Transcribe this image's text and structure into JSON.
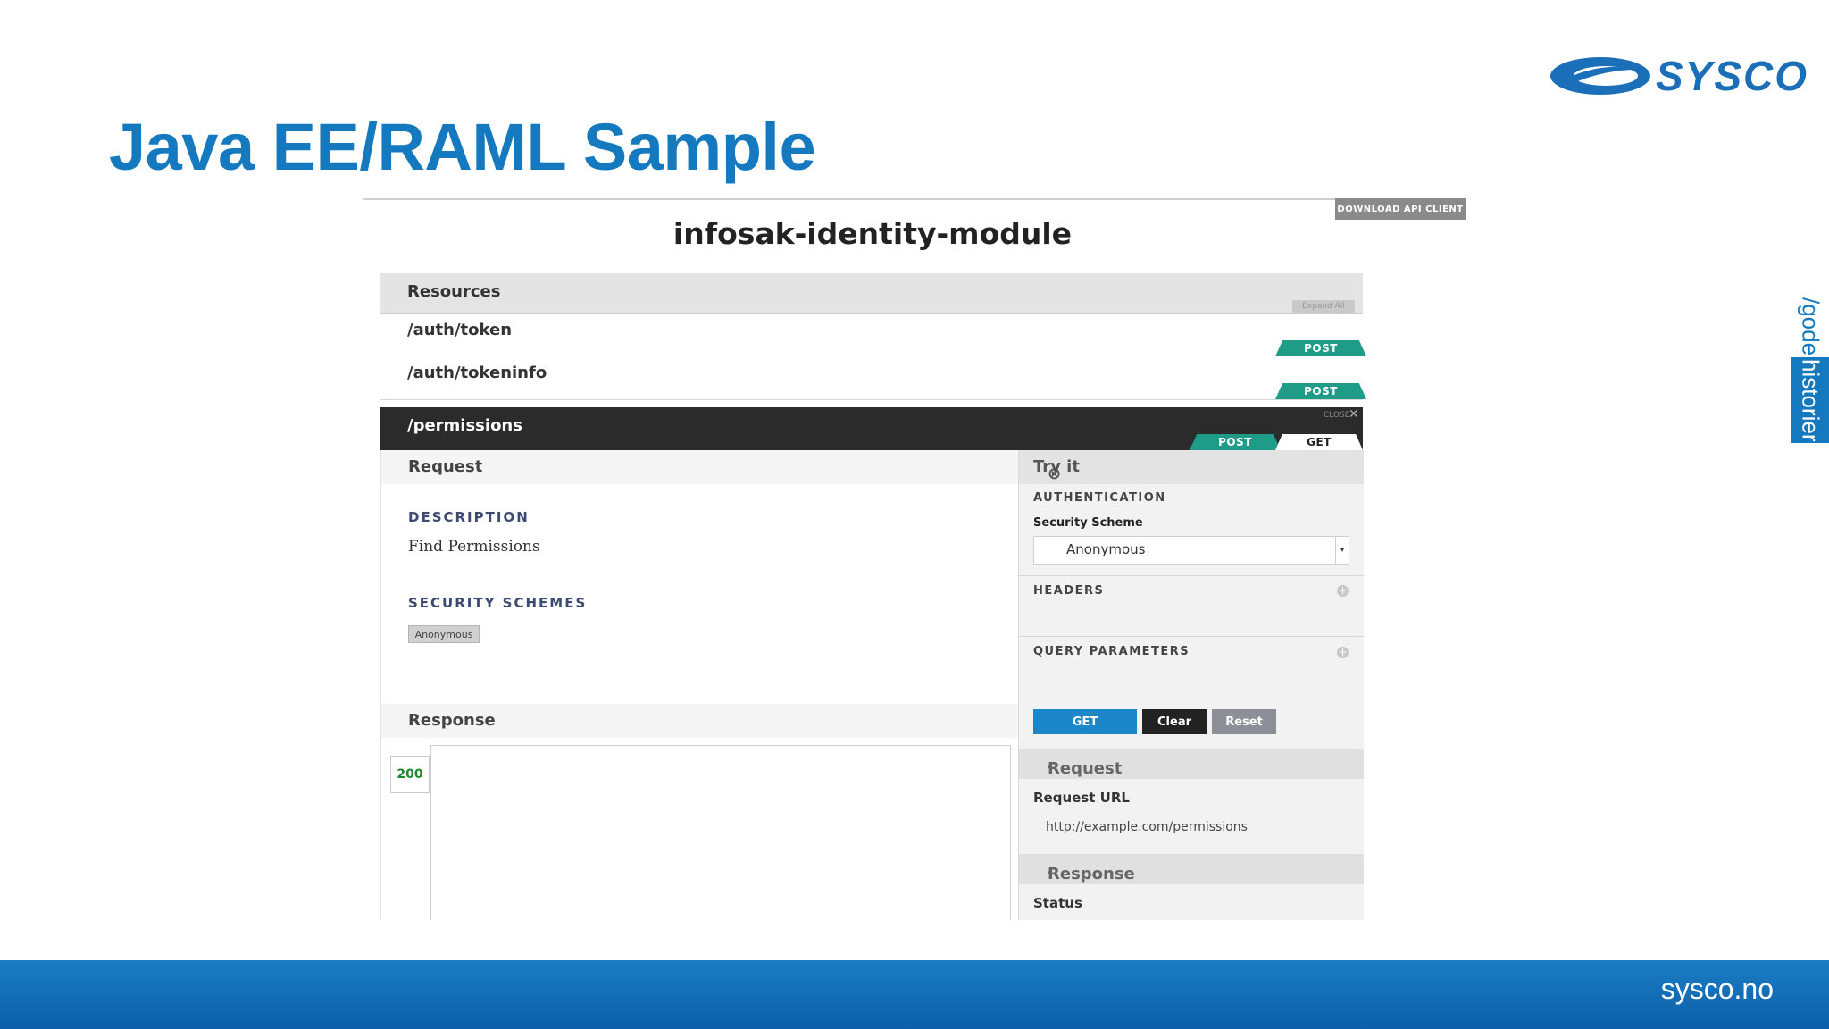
{
  "slide": {
    "title": "Java EE/RAML Sample",
    "logo_text": "SYSCO",
    "side_tab_slash": "/gode",
    "side_tab_word": "historier",
    "footer_text": "sysco.no"
  },
  "api": {
    "download_label": "DOWNLOAD API CLIENT",
    "title": "infosak-identity-module",
    "resources_label": "Resources",
    "expand_all": "Expand All",
    "rows": [
      {
        "path": "/auth/token",
        "method": "POST"
      },
      {
        "path": "/auth/tokeninfo",
        "method": "POST"
      }
    ],
    "active": {
      "path": "/permissions",
      "close_label": "CLOSE",
      "methods": [
        "POST",
        "GET"
      ]
    },
    "request": {
      "heading": "Request",
      "description_head": "DESCRIPTION",
      "description_text": "Find Permissions",
      "security_head": "SECURITY SCHEMES",
      "security_tag": "Anonymous",
      "response_heading": "Response",
      "status_code": "200"
    },
    "try_it": {
      "heading": "Try it",
      "auth_head": "AUTHENTICATION",
      "security_scheme_label": "Security Scheme",
      "security_scheme_value": "Anonymous",
      "headers_head": "HEADERS",
      "query_head": "QUERY PARAMETERS",
      "get_button": "GET",
      "clear_button": "Clear",
      "reset_button": "Reset",
      "request_sub": "Request",
      "request_url_label": "Request URL",
      "request_url": "http://example.com/permissions",
      "response_sub": "Response",
      "status_label": "Status"
    }
  },
  "colors": {
    "title_blue": "#1479bf",
    "post_green": "#1e9c88",
    "get_blue": "#1b87c9",
    "clear_black": "#222222",
    "reset_gray": "#8e8e98"
  }
}
